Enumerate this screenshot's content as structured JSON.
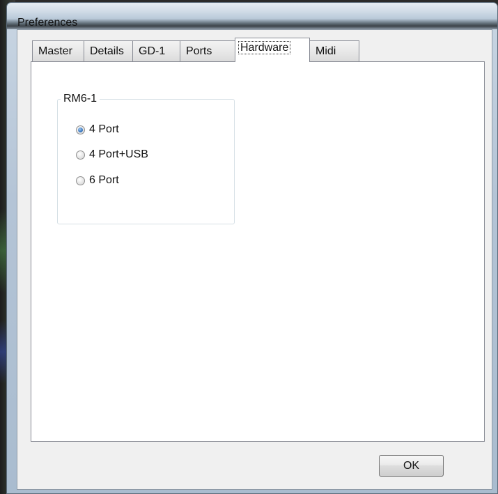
{
  "window": {
    "title": "Preferences"
  },
  "tabs": [
    {
      "label": "Master",
      "active": false
    },
    {
      "label": "Details",
      "active": false
    },
    {
      "label": "GD-1",
      "active": false
    },
    {
      "label": "Ports",
      "active": false
    },
    {
      "label": "Hardware",
      "active": true
    },
    {
      "label": "Midi",
      "active": false
    }
  ],
  "hardware": {
    "group_title": "RM6-1",
    "options": [
      {
        "label": "4 Port",
        "selected": true
      },
      {
        "label": "4 Port+USB",
        "selected": false
      },
      {
        "label": "6 Port",
        "selected": false
      }
    ]
  },
  "buttons": {
    "ok_label": "OK"
  }
}
